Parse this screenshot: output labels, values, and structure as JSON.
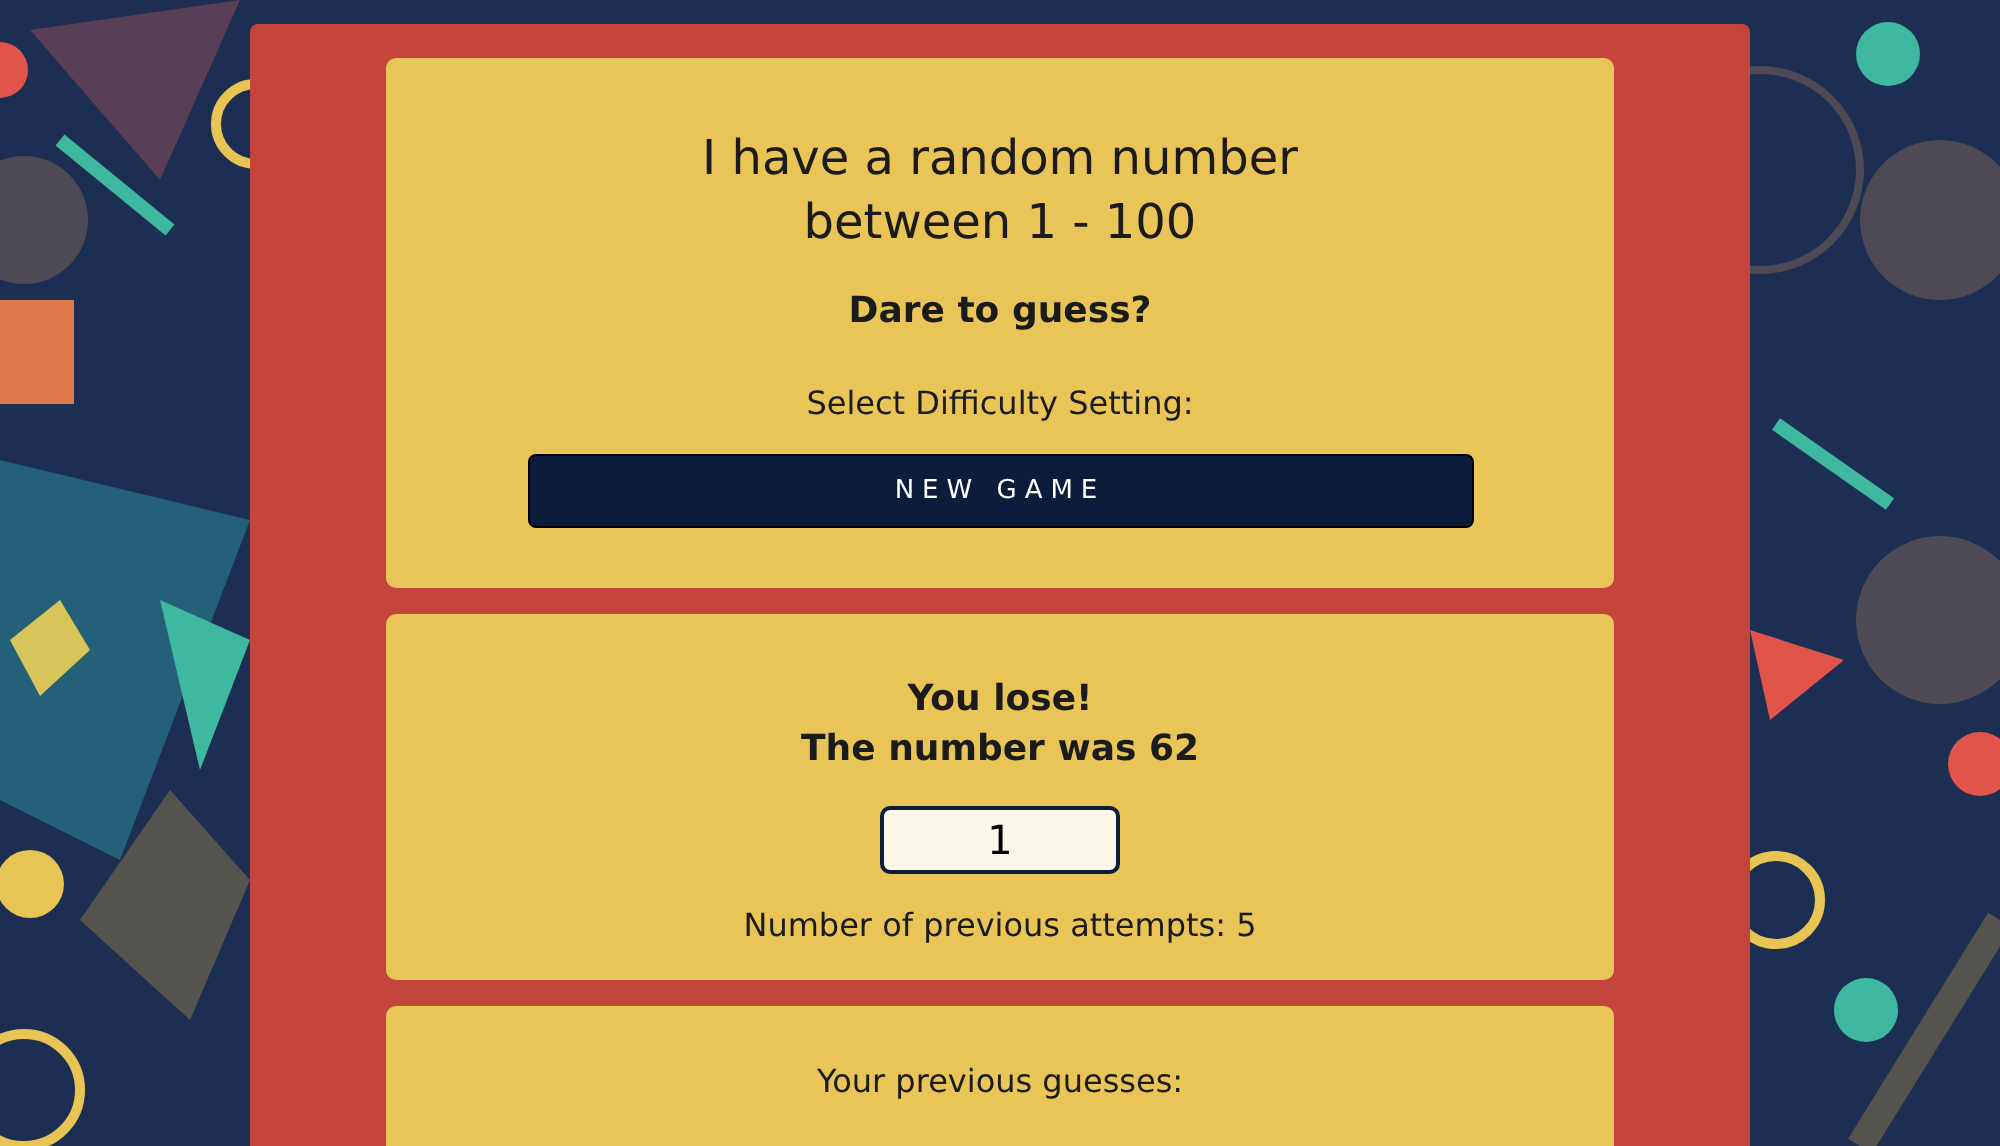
{
  "intro": {
    "title_lines": [
      "I have a random number",
      "between 1 - 100"
    ],
    "subtitle": "Dare to guess?",
    "difficulty_label": "Select Difficulty Setting:",
    "new_game_button": "NEW GAME"
  },
  "result": {
    "message_lines": [
      "You lose!",
      "The number was 62"
    ],
    "guess_input": {
      "value": "1"
    },
    "attempts": "Number of previous attempts: 5"
  },
  "history": {
    "heading": "Your previous guesses:"
  }
}
